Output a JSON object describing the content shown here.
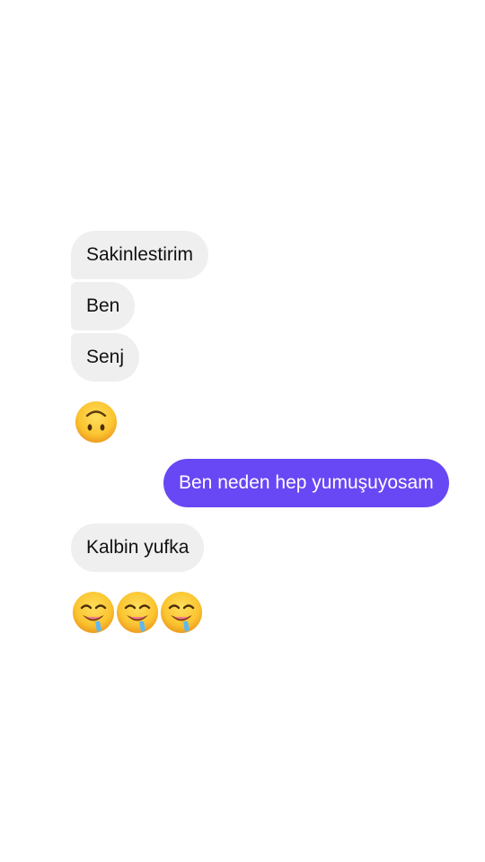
{
  "messages": {
    "incoming_1": "Sakinlestirim",
    "incoming_2": "Ben",
    "incoming_3": "Senj",
    "outgoing_1": "Ben neden hep yumuşuyosam",
    "incoming_4": "Kalbin yufka"
  },
  "emoji": {
    "reaction_1": "upside-down-face-icon",
    "reaction_2": [
      "drooling-face-icon",
      "drooling-face-icon",
      "drooling-face-icon"
    ]
  },
  "colors": {
    "outgoing_bubble": "#6847f4",
    "incoming_bubble": "#efeff0",
    "emoji_face": "#fbc531"
  }
}
